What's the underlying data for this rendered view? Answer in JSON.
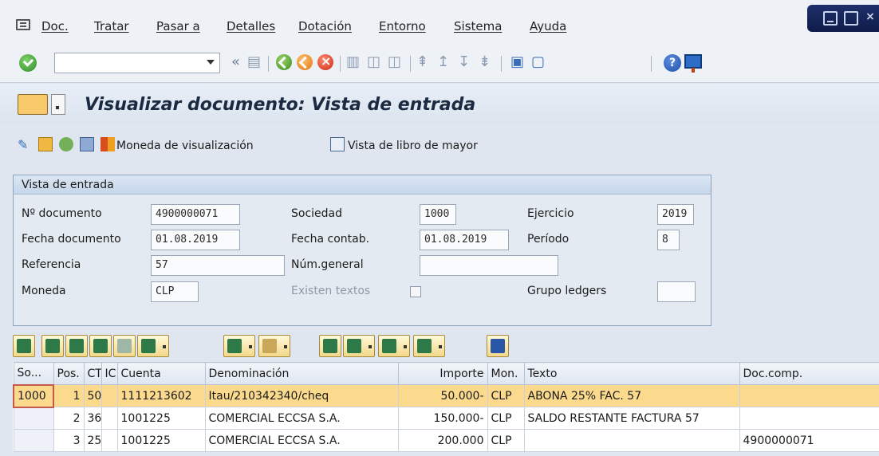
{
  "menu": {
    "items": [
      "Doc.",
      "Tratar",
      "Pasar a",
      "Detalles",
      "Dotación",
      "Entorno",
      "Sistema",
      "Ayuda"
    ]
  },
  "toolbar": {
    "command_value": ""
  },
  "title": "Visualizar documento: Vista de entrada",
  "app_toolbar": {
    "currency_button": "Moneda de visualización",
    "ledger_button": "Vista de libro de mayor"
  },
  "entry_view": {
    "header": "Vista de entrada",
    "doc_number_label": "Nº documento",
    "doc_number": "4900000071",
    "company_label": "Sociedad",
    "company": "1000",
    "fiscal_year_label": "Ejercicio",
    "fiscal_year": "2019",
    "doc_date_label": "Fecha documento",
    "doc_date": "01.08.2019",
    "posting_date_label": "Fecha contab.",
    "posting_date": "01.08.2019",
    "period_label": "Período",
    "period": "8",
    "reference_label": "Referencia",
    "reference": "57",
    "cross_company_label": "Núm.general",
    "cross_company": "",
    "currency_label": "Moneda",
    "currency": "CLP",
    "texts_exist_label": "Existen textos",
    "ledger_group_label": "Grupo ledgers",
    "ledger_group": ""
  },
  "table": {
    "columns": [
      "So...",
      "Pos.",
      "CT",
      "IC",
      "Cuenta",
      "Denominación",
      "Importe",
      "Mon.",
      "Texto",
      "Doc.comp."
    ],
    "rows": [
      [
        "1000",
        "1",
        "50",
        "",
        "1111213602",
        "Itau/210342340/cheq",
        "50.000-",
        "CLP",
        "ABONA 25% FAC. 57",
        ""
      ],
      [
        "",
        "2",
        "36",
        "",
        "1001225",
        "COMERCIAL ECCSA S.A.",
        "150.000-",
        "CLP",
        "SALDO RESTANTE FACTURA 57",
        ""
      ],
      [
        "",
        "3",
        "25",
        "",
        "1001225",
        "COMERCIAL ECCSA S.A.",
        "200.000",
        "CLP",
        "",
        "4900000071"
      ]
    ]
  },
  "colors": {
    "selected_row": "#fbd98d",
    "title_text": "#1a2a40",
    "window_controls": "#1e2f6a"
  }
}
